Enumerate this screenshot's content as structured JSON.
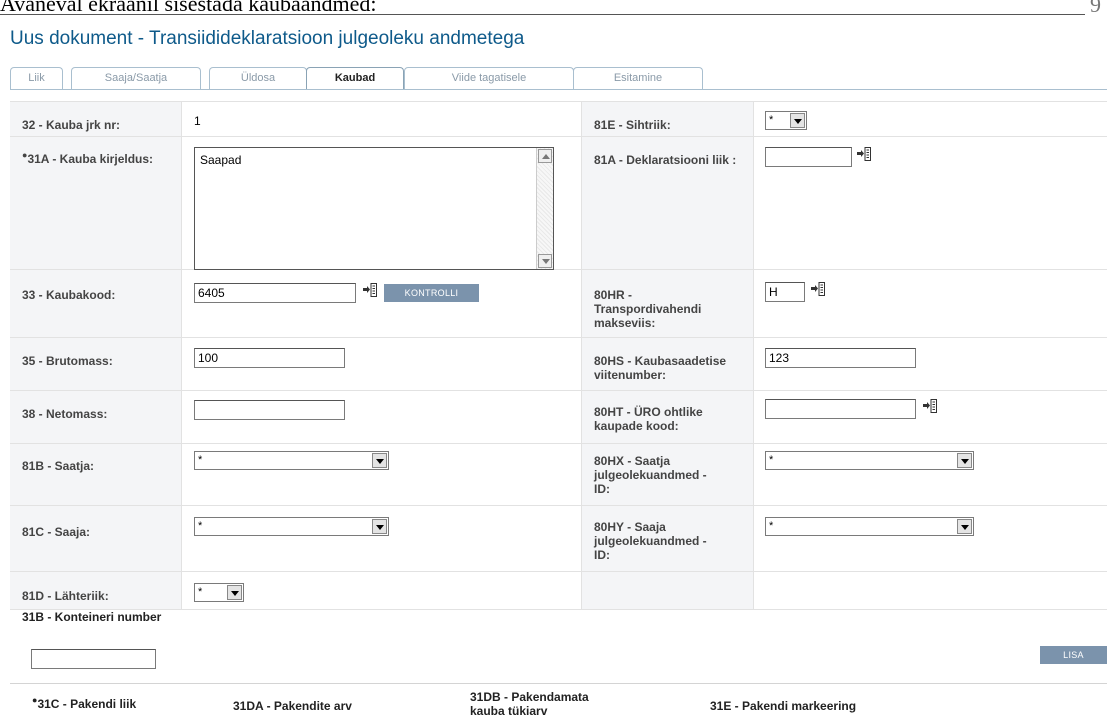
{
  "caption": "Avaneval ekraanil sisestada kaubaandmed:",
  "page_number": "9",
  "title": "Uus dokument - Transiidideklaratsioon julgeoleku andmetega",
  "tabs": [
    "Liik",
    "Saaja/Saatja",
    "Üldosa",
    "Kaubad",
    "Viide tagatisele",
    "Esitamine"
  ],
  "active_tab": "Kaubad",
  "fields": {
    "f32": {
      "label": "32 - Kauba jrk nr:",
      "value": "1"
    },
    "f31a": {
      "label": "31A - Kauba kirjeldus:",
      "value": "Saapad"
    },
    "f33": {
      "label": "33 - Kaubakood:",
      "value": "6405",
      "button": "KONTROLLI"
    },
    "f35": {
      "label": "35 - Brutomass:",
      "value": "100"
    },
    "f38": {
      "label": "38 - Netomass:",
      "value": ""
    },
    "f81b": {
      "label": "81B - Saatja:",
      "value": "*"
    },
    "f81c": {
      "label": "81C - Saaja:",
      "value": "*"
    },
    "f81d": {
      "label": "81D - Lähteriik:",
      "value": "*"
    },
    "f81e": {
      "label": "81E - Sihtriik:",
      "value": "*"
    },
    "f81a": {
      "label": "81A - Deklaratsiooni liik :",
      "value": ""
    },
    "f80hr": {
      "label": "80HR - Transpordivahendi makseviis:",
      "value": "H"
    },
    "f80hs": {
      "label": "80HS - Kaubasaadetise viitenumber:",
      "value": "123"
    },
    "f80ht": {
      "label": "80HT - ÜRO ohtlike kaupade kood:",
      "value": ""
    },
    "f80hx": {
      "label": "80HX - Saatja julgeolekuandmed - ID:",
      "value": "*"
    },
    "f80hy": {
      "label": "80HY - Saaja julgeolekuandmed - ID:",
      "value": "*"
    }
  },
  "container": {
    "label": "31B - Konteineri number",
    "value": "",
    "button": "LISA"
  },
  "package_columns": [
    "31C - Pakendi liik",
    "31DA - Pakendite arv",
    "31DB - Pakendamata kauba tükiarv",
    "31E - Pakendi markeering"
  ],
  "colors": {
    "title": "#0e5a8a",
    "button": "#7b93ac",
    "label_bg": "#f4f5f7"
  }
}
